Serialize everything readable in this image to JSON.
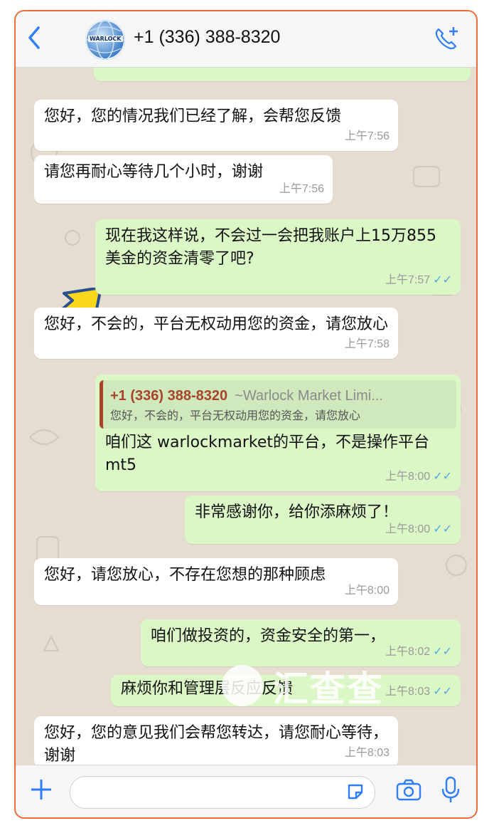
{
  "header": {
    "back_icon": "chevron-left-icon",
    "avatar_text": "WARLOCK",
    "title": "+1 (336) 388-8320",
    "call_icon": "phone-add-icon"
  },
  "messages": [
    {
      "text": "您好，您的情况我们已经了解，会帮您反馈",
      "time": "上午7:56"
    },
    {
      "text": "请您再耐心等待几个小时，谢谢",
      "time": "上午7:56"
    },
    {
      "text": "现在我这样说，不会过一会把我账户上15万855美金的资金清零了吧?",
      "time": "上午7:57"
    },
    {
      "text": "您好，不会的，平台无权动用您的资金，请您放心",
      "time": "上午7:58"
    },
    {
      "quote_name": "+1 (336) 388-8320",
      "quote_sub": "~Warlock Market Limi...",
      "quote_text": "您好，不会的，平台无权动用您的资金，请您放心",
      "text": "咱们这 warlockmarket的平台，不是操作平台 mt5",
      "time": "上午8:00"
    },
    {
      "text": "非常感谢你，给你添麻烦了！",
      "time": "上午8:00"
    },
    {
      "text": "您好，请您放心，不存在您想的那种顾虑",
      "time": "上午8:00"
    },
    {
      "text": "咱们做投资的，资金安全的第一，",
      "time": "上午8:02"
    },
    {
      "text": "麻烦你和管理层反应反馈",
      "time": "上午8:03"
    },
    {
      "text": "您好，您的意见我们会帮您转达，请您耐心等待，谢谢",
      "time": "上午8:03"
    }
  ],
  "watermark": "汇查查",
  "colors": {
    "accent": "#2f7ef6",
    "outgoing": "#dbf7c6",
    "incoming": "#ffffff",
    "quote_name": "#a8432a",
    "read_tick": "#4fa6e3",
    "frame": "#ef6a3a"
  },
  "input": {
    "plus_icon": "plus-icon",
    "sticker_icon": "sticker-icon",
    "camera_icon": "camera-icon",
    "mic_icon": "microphone-icon"
  }
}
